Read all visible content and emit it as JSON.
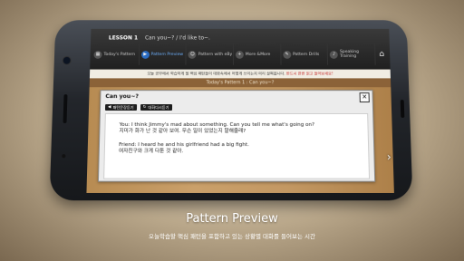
{
  "header": {
    "lesson": "LESSON 1",
    "lesson_title": "Can you~? / I'd like to~."
  },
  "nav": [
    {
      "label": "Today's Pattern",
      "icon": "calendar-icon"
    },
    {
      "label": "Pattern Preview",
      "icon": "preview-icon",
      "active": true
    },
    {
      "label": "Pattern with eBy",
      "icon": "eby-icon"
    },
    {
      "label": "More &More",
      "icon": "more-icon"
    },
    {
      "label": "Pattern Drills",
      "icon": "drill-icon"
    },
    {
      "label": "Speaking Training",
      "icon": "speaking-icon"
    }
  ],
  "home_icon": "home-icon",
  "notice": {
    "text": "오늘 공부에서 학습하게 될 핵심 패턴들이 대화속에서 어떻게 쓰이는지 미리 살펴봅니다.",
    "highlight": "반드시 한번 읽고 들어보세요!"
  },
  "section_title": "Today's Pattern 1 : Can you~?",
  "dialog": {
    "title": "Can you~?",
    "close_label": "✕",
    "buttons": [
      {
        "label": "패턴문장듣기",
        "icon": "speaker-icon"
      },
      {
        "label": "대화다시듣기",
        "icon": "replay-icon"
      }
    ],
    "lines": [
      "You: I think Jimmy's mad about something. Can you tell me what's going on?",
      "지미가 화가 난 것 같아 보여. 무슨 일이 있었는지 말해줄래?",
      "Friend: I heard he and his girlfriend had a big fight.",
      "여자친구와 크게 다툰 것 같아."
    ]
  },
  "next_arrow": "›",
  "caption": {
    "title": "Pattern Preview",
    "subtitle": "오늘학습할 핵심 패턴을 포함하고 있는 상황별 대화를 들어보는 시간"
  }
}
